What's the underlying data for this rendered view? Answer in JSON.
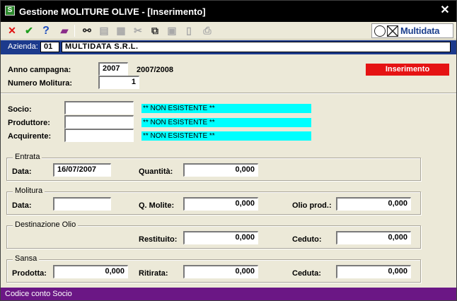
{
  "window": {
    "title": "Gestione MOLITURE OLIVE - [Inserimento]",
    "app_icon": "S",
    "close_glyph": "✕"
  },
  "toolbar": {
    "buttons": [
      {
        "name": "cancel-icon",
        "glyph": "✕",
        "color": "#e01010"
      },
      {
        "name": "confirm-icon",
        "glyph": "✔",
        "color": "#1e9e1e"
      },
      {
        "name": "help-icon",
        "glyph": "?",
        "color": "#1f4fbf"
      },
      {
        "name": "book-icon",
        "glyph": "▰",
        "color": "#8a2d8a"
      },
      {
        "name": "binoculars-icon",
        "glyph": "⚯",
        "color": "#202020"
      },
      {
        "name": "edit-icon",
        "glyph": "▤",
        "color": "#a8a8a8"
      },
      {
        "name": "edit-check-icon",
        "glyph": "▦",
        "color": "#a8a8a8"
      },
      {
        "name": "scissors-icon",
        "glyph": "✂",
        "color": "#a8a8a8"
      },
      {
        "name": "copy-icon",
        "glyph": "⧉",
        "color": "#303030"
      },
      {
        "name": "paste-icon",
        "glyph": "▣",
        "color": "#a8a8a8"
      },
      {
        "name": "new-document-icon",
        "glyph": "▯",
        "color": "#a8a8a8"
      },
      {
        "name": "print-icon",
        "glyph": "⎙",
        "color": "#a8a8a8"
      }
    ],
    "brand_text": "Multidata"
  },
  "company": {
    "label": "Azienda:",
    "code": "01",
    "name": "MULTIDATA S.R.L."
  },
  "header": {
    "anno_label": "Anno campagna:",
    "anno_value": "2007",
    "anno_range": "2007/2008",
    "numero_label": "Numero Molitura:",
    "numero_value": "1",
    "status": "Inserimento",
    "status_color": "#e51313"
  },
  "parties": {
    "socio_label": "Socio:",
    "socio_value": "",
    "socio_status": "** NON ESISTENTE **",
    "produttore_label": "Produttore:",
    "produttore_value": "",
    "produttore_status": "** NON ESISTENTE **",
    "acquirente_label": "Acquirente:",
    "acquirente_value": "",
    "acquirente_status": "** NON ESISTENTE **"
  },
  "entrata": {
    "title": "Entrata",
    "data_label": "Data:",
    "data_value": "16/07/2007",
    "quantita_label": "Quantità:",
    "quantita_value": "0,000"
  },
  "molitura": {
    "title": "Molitura",
    "data_label": "Data:",
    "data_value": "",
    "molite_label": "Q. Molite:",
    "molite_value": "0,000",
    "olio_label": "Olio prod.:",
    "olio_value": "0,000"
  },
  "destinazione": {
    "title": "Destinazione Olio",
    "restituito_label": "Restituito:",
    "restituito_value": "0,000",
    "ceduto_label": "Ceduto:",
    "ceduto_value": "0,000"
  },
  "sansa": {
    "title": "Sansa",
    "prodotta_label": "Prodotta:",
    "prodotta_value": "0,000",
    "ritirata_label": "Ritirata:",
    "ritirata_value": "0,000",
    "ceduta_label": "Ceduta:",
    "ceduta_value": "0,000"
  },
  "statusbar": {
    "text": "Codice conto Socio",
    "color": "#6b1785"
  }
}
